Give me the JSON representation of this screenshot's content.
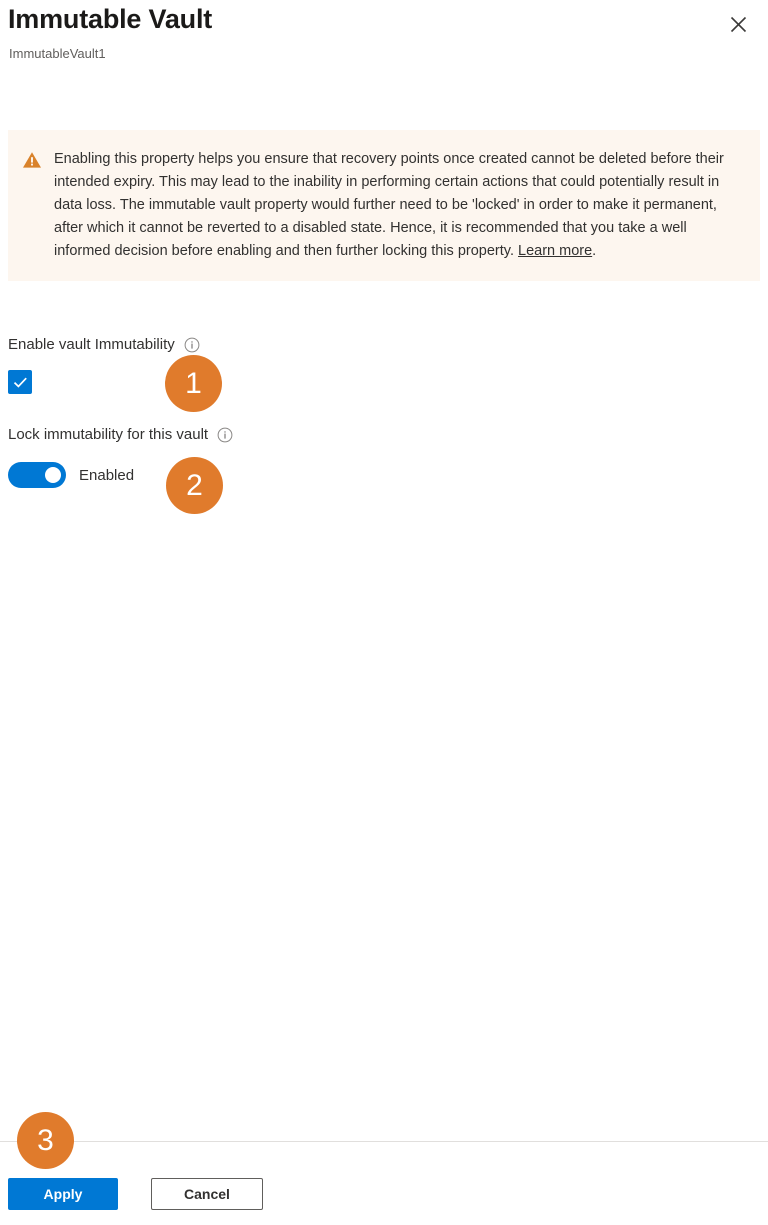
{
  "header": {
    "title": "Immutable Vault",
    "subtitle": "ImmutableVault1",
    "close_icon": "close-icon"
  },
  "banner": {
    "icon": "warning-triangle-icon",
    "text": "Enabling this property helps you ensure that recovery points once created cannot be deleted before their intended expiry. This may lead to the inability in performing certain actions that could potentially result in data loss. The immutable vault property would further need to be 'locked' in order to make it permanent, after which it cannot be reverted to a disabled state. Hence, it is recommended that you take a well informed decision before enabling and then further locking this property. ",
    "link_label": "Learn more",
    "text_after_link": ".",
    "background_color": "#fdf6ef",
    "icon_color": "#d83b01"
  },
  "fields": {
    "enable_immutability": {
      "label": "Enable vault Immutability",
      "info_icon": "info-circle-icon",
      "checkbox_checked": true,
      "accent_color": "#0078d4"
    },
    "lock_immutability": {
      "label": "Lock immutability for this vault",
      "info_icon": "info-circle-icon",
      "toggle_on": true,
      "toggle_state_label": "Enabled",
      "accent_color": "#0078d4"
    }
  },
  "footer": {
    "apply_label": "Apply",
    "cancel_label": "Cancel",
    "primary_color": "#0078d4"
  },
  "annotations": {
    "badge_color": "#e07b2c",
    "items": [
      {
        "number": "1"
      },
      {
        "number": "2"
      },
      {
        "number": "3"
      }
    ]
  }
}
